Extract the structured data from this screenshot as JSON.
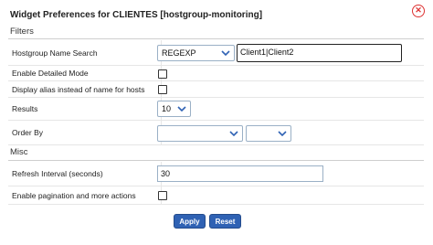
{
  "dialog": {
    "title": "Widget Preferences for CLIENTES [hostgroup-monitoring]",
    "close_icon": "close-circle-icon",
    "close_glyph": "✕"
  },
  "sections": {
    "filters": "Filters",
    "misc": "Misc"
  },
  "fields": {
    "hostgroup_name_search": {
      "label": "Hostgroup Name Search",
      "operator": "REGEXP",
      "value": "Client1|Client2"
    },
    "enable_detailed_mode": {
      "label": "Enable Detailed Mode",
      "checked": false
    },
    "display_alias": {
      "label": "Display alias instead of name for hosts",
      "checked": false
    },
    "results": {
      "label": "Results",
      "value": "10"
    },
    "order_by": {
      "label": "Order By",
      "field_value": "",
      "direction_value": ""
    },
    "refresh_interval": {
      "label": "Refresh Interval (seconds)",
      "value": "30"
    },
    "enable_pagination": {
      "label": "Enable pagination and more actions",
      "checked": false
    }
  },
  "buttons": {
    "apply": "Apply",
    "reset": "Reset"
  },
  "colors": {
    "accent": "#2f62b4",
    "close": "#dd3333"
  }
}
